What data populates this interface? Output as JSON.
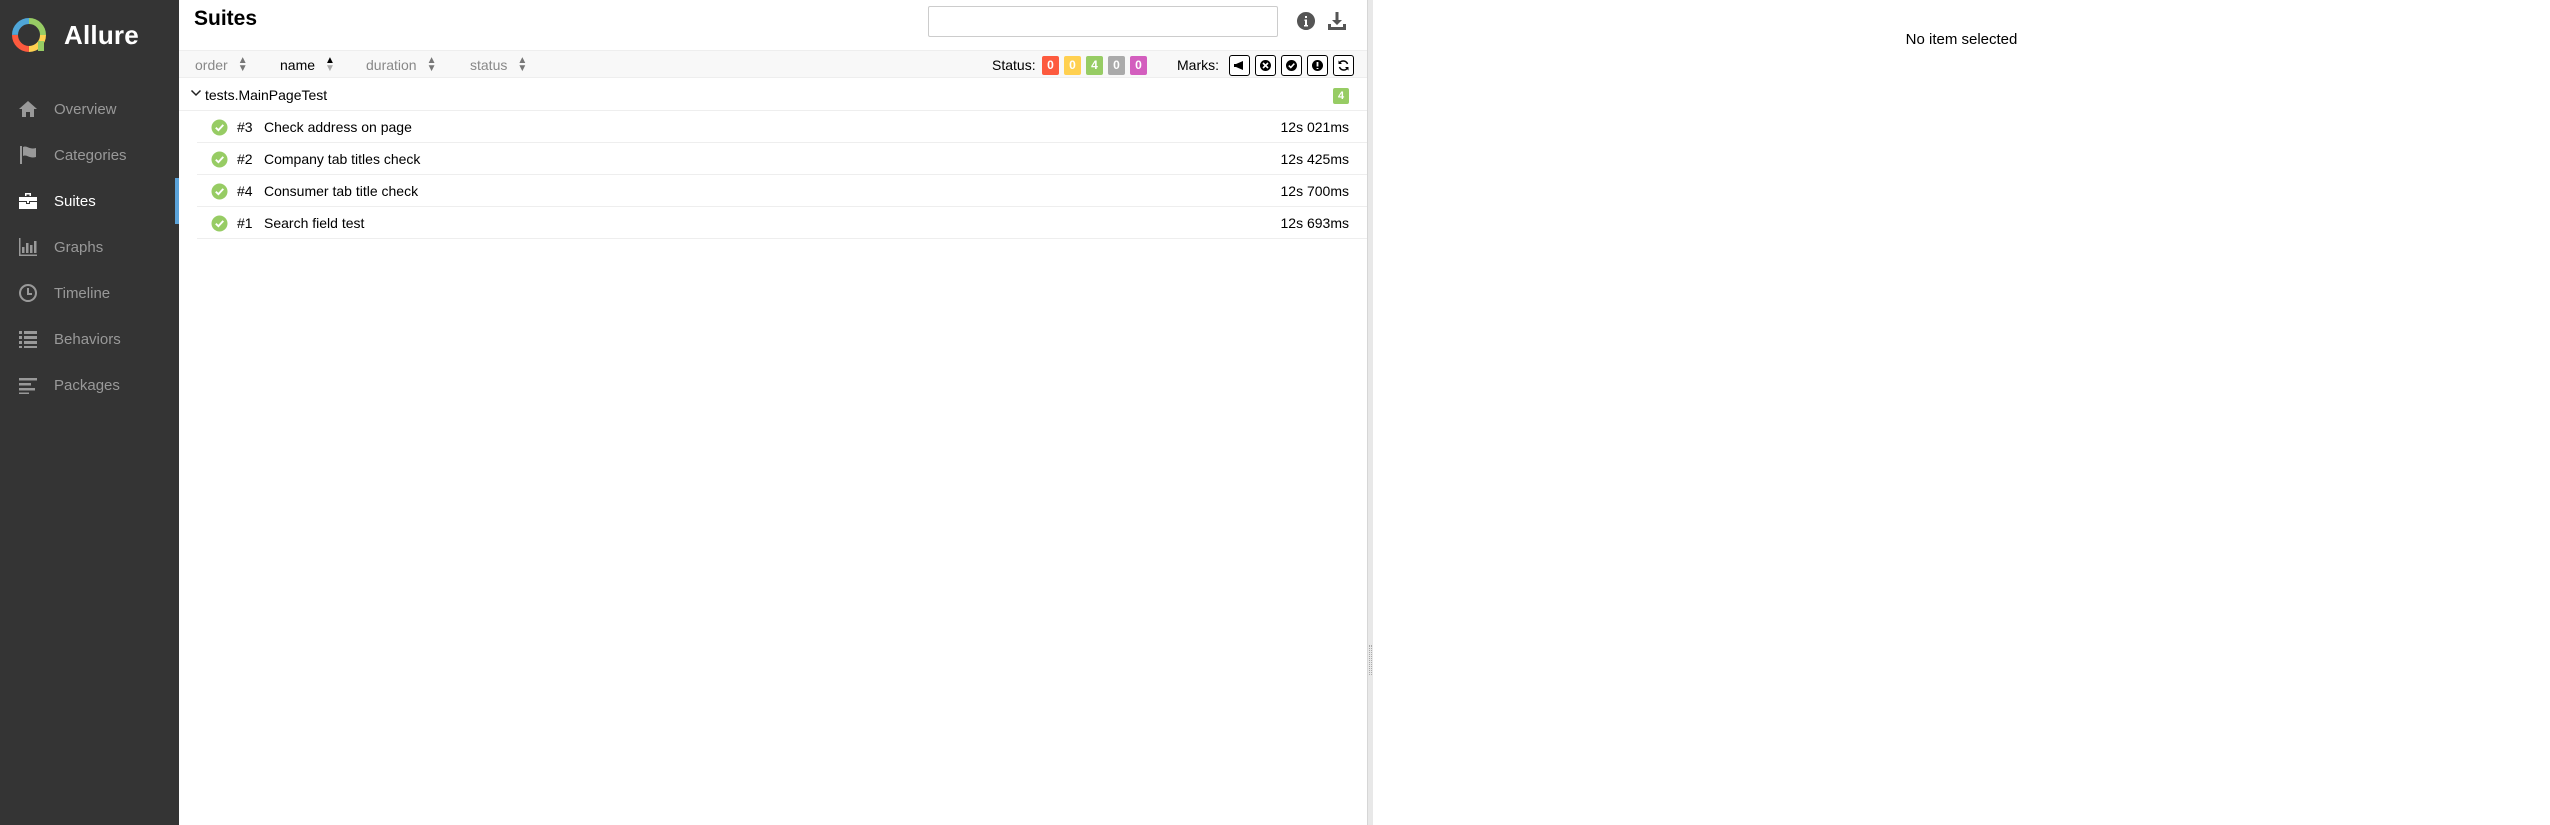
{
  "app": {
    "name": "Allure"
  },
  "sidebar": {
    "items": [
      {
        "label": "Overview",
        "icon": "home-icon"
      },
      {
        "label": "Categories",
        "icon": "flag-icon"
      },
      {
        "label": "Suites",
        "icon": "briefcase-icon",
        "active": true
      },
      {
        "label": "Graphs",
        "icon": "bar-chart-icon"
      },
      {
        "label": "Timeline",
        "icon": "clock-icon"
      },
      {
        "label": "Behaviors",
        "icon": "list-icon"
      },
      {
        "label": "Packages",
        "icon": "align-left-icon"
      }
    ]
  },
  "main": {
    "title": "Suites",
    "search": {
      "value": "",
      "placeholder": ""
    },
    "sort": {
      "order": "order",
      "name": "name",
      "duration": "duration",
      "status": "status"
    },
    "status_label": "Status:",
    "status_counts": [
      {
        "status": "failed",
        "count": "0",
        "color": "#fd5a3e"
      },
      {
        "status": "broken",
        "count": "0",
        "color": "#ffd050"
      },
      {
        "status": "passed",
        "count": "4",
        "color": "#97cc64"
      },
      {
        "status": "skipped",
        "count": "0",
        "color": "#aaaaaa"
      },
      {
        "status": "unknown",
        "count": "0",
        "color": "#d35ebe"
      }
    ],
    "marks_label": "Marks:",
    "marks": [
      "flaky-icon",
      "new-failed-icon",
      "new-passed-icon",
      "new-broken-icon",
      "retries-icon"
    ],
    "group": {
      "name": "tests.MainPageTest",
      "count": "4"
    },
    "tests": [
      {
        "num": "#3",
        "name": "Check address on page",
        "duration": "12s 021ms",
        "status": "passed"
      },
      {
        "num": "#2",
        "name": "Company tab titles check",
        "duration": "12s 425ms",
        "status": "passed"
      },
      {
        "num": "#4",
        "name": "Consumer tab title check",
        "duration": "12s 700ms",
        "status": "passed"
      },
      {
        "num": "#1",
        "name": "Search field test",
        "duration": "12s 693ms",
        "status": "passed"
      }
    ]
  },
  "detail": {
    "empty_text": "No item selected"
  }
}
